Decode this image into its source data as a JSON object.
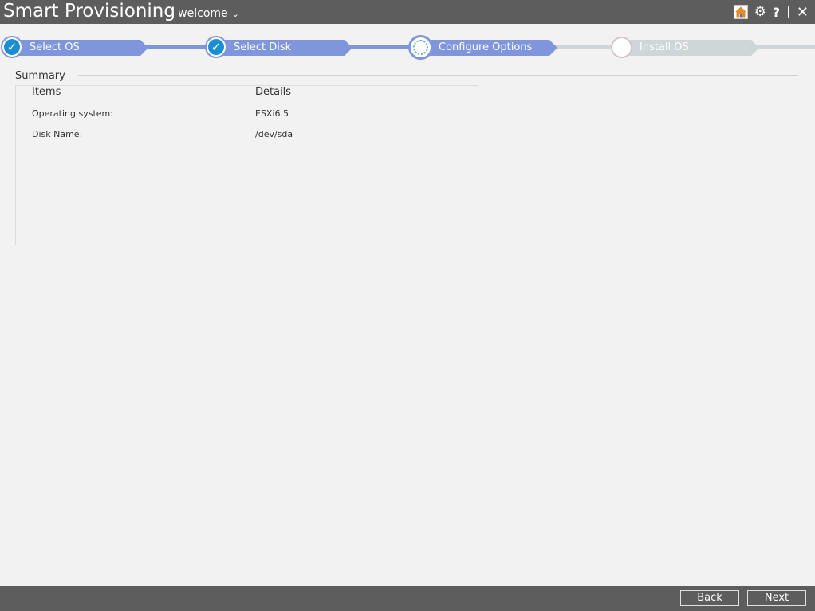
{
  "header": {
    "app_title": "Smart Provisioning",
    "user_menu_label": "| welcome",
    "icons": [
      "home-icon",
      "gear-icon",
      "help-icon",
      "close-icon"
    ],
    "help_glyph": "?",
    "separator": "|",
    "close_glyph": "✕"
  },
  "wizard": {
    "steps": [
      {
        "label": "Select OS",
        "state": "completed"
      },
      {
        "label": "Select Disk",
        "state": "completed"
      },
      {
        "label": "Configure Options",
        "state": "active"
      },
      {
        "label": "Install OS",
        "state": "pending"
      }
    ],
    "check_glyph": "✓"
  },
  "summary": {
    "title": "Summary",
    "columns": [
      "Items",
      "Details"
    ],
    "rows": [
      {
        "item": "Operating system:",
        "detail": "ESXi6.5"
      },
      {
        "item": "Disk Name:",
        "detail": "/dev/sda"
      }
    ]
  },
  "footer": {
    "back_label": "Back",
    "next_label": "Next"
  },
  "colors": {
    "header_bg": "#5d5d5d",
    "step_complete": "#7f96dd",
    "step_pending": "#cfd6d8",
    "check_circle": "#1a8ed3",
    "page_bg": "#f2f2f2"
  }
}
